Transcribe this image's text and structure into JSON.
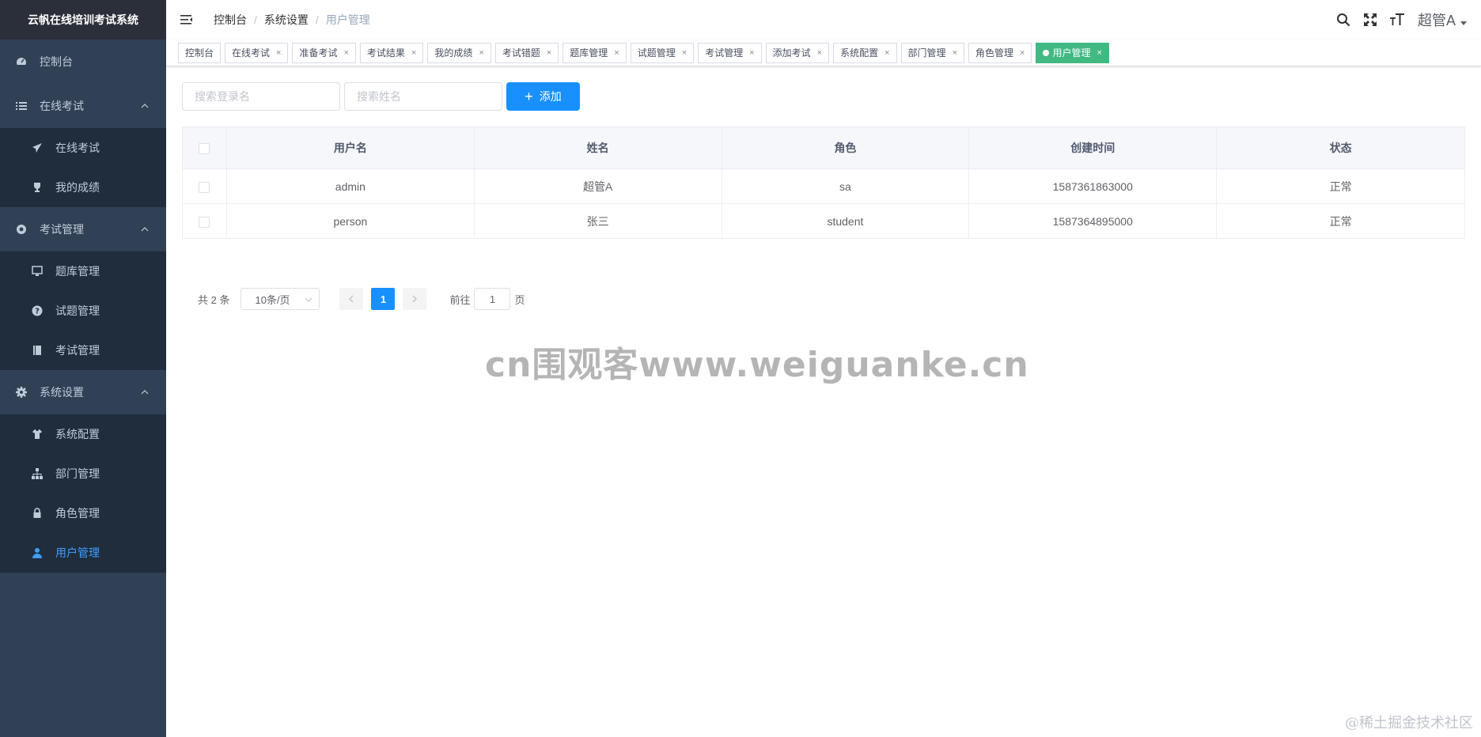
{
  "app": {
    "title": "云帆在线培训考试系统"
  },
  "sidebar": {
    "dashboard": "控制台",
    "groups": [
      {
        "label": "在线考试",
        "items": [
          "在线考试",
          "我的成绩"
        ]
      },
      {
        "label": "考试管理",
        "items": [
          "题库管理",
          "试题管理",
          "考试管理"
        ]
      },
      {
        "label": "系统设置",
        "items": [
          "系统配置",
          "部门管理",
          "角色管理",
          "用户管理"
        ]
      }
    ]
  },
  "navbar": {
    "breadcrumb": [
      "控制台",
      "系统设置",
      "用户管理"
    ],
    "user": "超管A"
  },
  "tags": [
    "控制台",
    "在线考试",
    "准备考试",
    "考试结果",
    "我的成绩",
    "考试错题",
    "题库管理",
    "试题管理",
    "考试管理",
    "添加考试",
    "系统配置",
    "部门管理",
    "角色管理",
    "用户管理"
  ],
  "filter": {
    "login_placeholder": "搜索登录名",
    "name_placeholder": "搜索姓名",
    "add_label": "添加"
  },
  "table": {
    "headers": [
      "用户名",
      "姓名",
      "角色",
      "创建时间",
      "状态"
    ],
    "rows": [
      [
        "admin",
        "超管A",
        "sa",
        "1587361863000",
        "正常"
      ],
      [
        "person",
        "张三",
        "student",
        "1587364895000",
        "正常"
      ]
    ]
  },
  "pagination": {
    "total": "共 2 条",
    "page_size": "10条/页",
    "current": "1",
    "goto_prefix": "前往",
    "goto_value": "1",
    "goto_suffix": "页"
  },
  "watermark": "cn围观客www.weiguanke.cn",
  "credit": "@稀土掘金技术社区",
  "colors": {
    "sidebar": "#304156",
    "primary": "#1890ff",
    "active_tag": "#42b983"
  }
}
